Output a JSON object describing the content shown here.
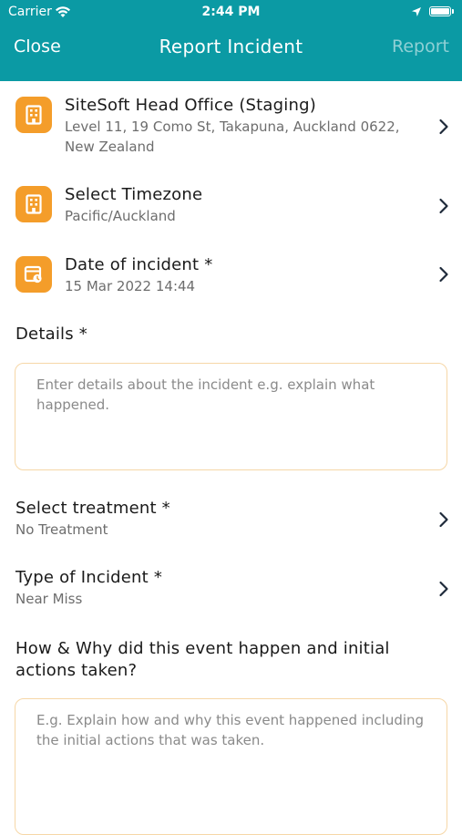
{
  "status_bar": {
    "carrier": "Carrier",
    "time": "2:44 PM"
  },
  "nav": {
    "close": "Close",
    "title": "Report Incident",
    "report": "Report"
  },
  "colors": {
    "header": "#0b9aa4",
    "accent": "#f49d2a",
    "report_disabled": "#8fd0d5"
  },
  "site": {
    "icon": "building-icon",
    "name": "SiteSoft Head Office (Staging)",
    "address": "Level 11, 19 Como St, Takapuna, Auckland 0622, New Zealand"
  },
  "timezone": {
    "icon": "building-icon",
    "label": "Select Timezone",
    "value": "Pacific/Auckland"
  },
  "date": {
    "icon": "calendar-icon",
    "label": "Date of incident *",
    "value": "15 Mar 2022 14:44"
  },
  "details": {
    "label": "Details *",
    "placeholder": "Enter details about the incident e.g. explain what happened."
  },
  "treatment": {
    "label": "Select treatment *",
    "value": "No Treatment"
  },
  "incident_type": {
    "label": "Type of Incident *",
    "value": "Near Miss"
  },
  "how_why": {
    "label": "How & Why did this event happen and initial actions taken?",
    "placeholder": "E.g. Explain how and why this event happened including the initial actions that was taken."
  }
}
